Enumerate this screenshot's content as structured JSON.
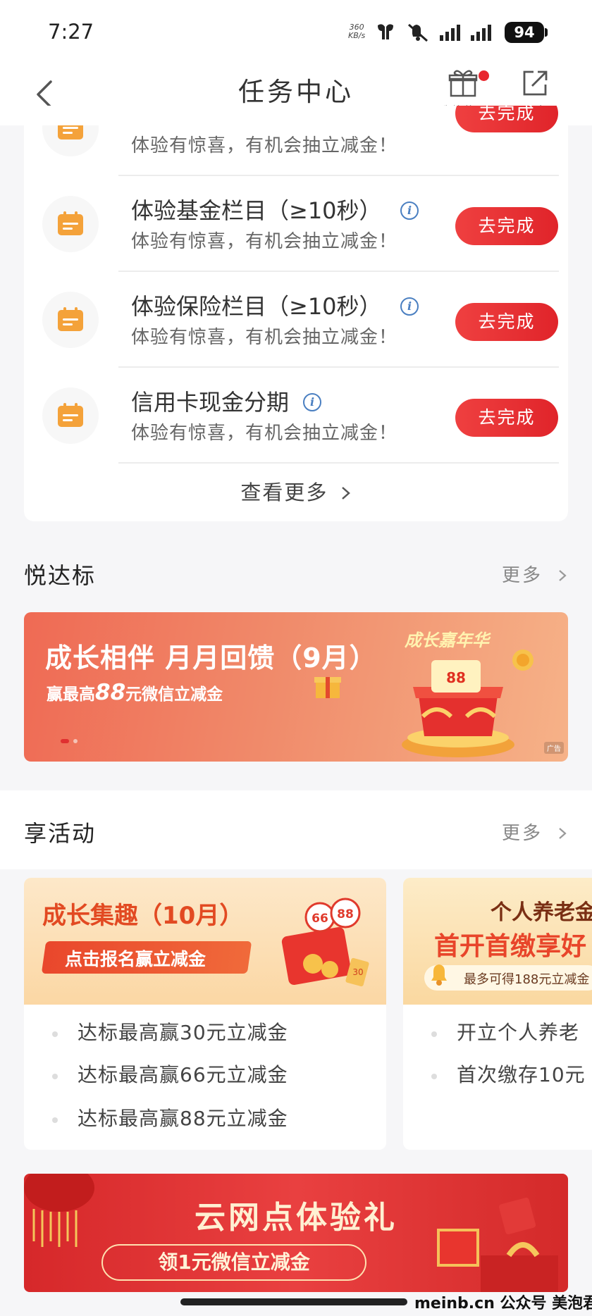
{
  "status_bar": {
    "time": "7:27",
    "net_speed_value": "360",
    "net_speed_unit": "KB/s",
    "battery": "94"
  },
  "header": {
    "title": "任务中心",
    "prizes_label": "我的奖品",
    "share_label": "分享"
  },
  "tasks": [
    {
      "title": "",
      "subtitle": "体验有惊喜，有机会抽立减金！",
      "button": "去完成"
    },
    {
      "title": "体验基金栏目（≥10秒）",
      "subtitle": "体验有惊喜，有机会抽立减金！",
      "button": "去完成"
    },
    {
      "title": "体验保险栏目（≥10秒）",
      "subtitle": "体验有惊喜，有机会抽立减金！",
      "button": "去完成"
    },
    {
      "title": "信用卡现金分期",
      "subtitle": "体验有惊喜，有机会抽立减金！",
      "button": "去完成"
    }
  ],
  "view_more": "查看更多",
  "section_yuedabiao": {
    "title": "悦达标",
    "more": "更多"
  },
  "banner_growth": {
    "title": "成长相伴 月月回馈（9月）",
    "subtitle_pre": "赢最高",
    "amount": "88",
    "subtitle_post": "元微信立减金",
    "badge": "成长嘉年华",
    "ad": "广告"
  },
  "section_activity": {
    "title": "享活动",
    "more": "更多"
  },
  "activity_cards": [
    {
      "banner_title": "成长集趣（10月）",
      "banner_sub": "点击报名赢立减金",
      "items": [
        "达标最高赢30元立减金",
        "达标最高赢66元立减金",
        "达标最高赢88元立减金"
      ]
    },
    {
      "banner_title": "个人养老金",
      "banner_sub": "首开首缴享好",
      "banner_note": "最多可得188元立减金",
      "items": [
        "开立个人养老",
        "首次缴存10元"
      ]
    }
  ],
  "banner_cloud": {
    "title": "云网点体验礼",
    "sub": "领1元微信立减金"
  },
  "watermark": "meinb.cn 公众号 美泡君",
  "colors": {
    "accent_red": "#e8262e",
    "icon_orange": "#f4a23a",
    "info_blue": "#4a7fc1"
  }
}
